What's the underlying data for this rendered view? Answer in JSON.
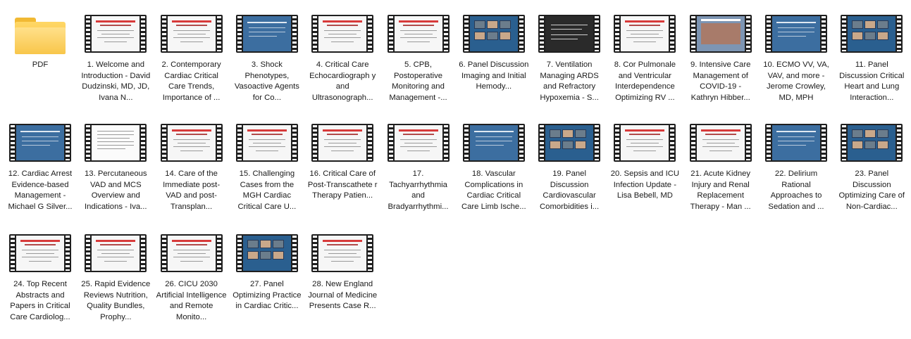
{
  "folder": {
    "label": "PDF"
  },
  "items": [
    {
      "label": "1. Welcome and Introduction - David Dudzinski, MD, JD, Ivana N...",
      "style": "slide"
    },
    {
      "label": "2. Contemporary Cardiac Critical Care Trends, Importance of ...",
      "style": "slide"
    },
    {
      "label": "3. Shock Phenotypes, Vasoactive Agents for Co...",
      "style": "blue"
    },
    {
      "label": "4. Critical Care Echocardiograph y and Ultrasonograph...",
      "style": "slide"
    },
    {
      "label": "5. CPB, Postoperative Monitoring and Management -...",
      "style": "slide"
    },
    {
      "label": "6. Panel Discussion Imaging and Initial Hemody...",
      "style": "panel"
    },
    {
      "label": "7. Ventilation Managing ARDS and Refractory Hypoxemia - S...",
      "style": "dark"
    },
    {
      "label": "8. Cor Pulmonale and Ventricular Interdependence Optimizing RV ...",
      "style": "slide"
    },
    {
      "label": "9. Intensive Care Management of COVID-19 - Kathryn Hibber...",
      "style": "photo"
    },
    {
      "label": "10. ECMO VV, VA, VAV, and more - Jerome Crowley, MD, MPH",
      "style": "blue"
    },
    {
      "label": "11. Panel Discussion Critical Heart and Lung Interaction...",
      "style": "panel"
    },
    {
      "label": "12. Cardiac Arrest Evidence-based Management - Michael G Silver...",
      "style": "blue"
    },
    {
      "label": "13. Percutaneous VAD and MCS Overview and Indications - Iva...",
      "style": "text"
    },
    {
      "label": "14. Care of the Immediate post-VAD and post-Transplan...",
      "style": "slide"
    },
    {
      "label": "15. Challenging Cases from the MGH Cardiac Critical Care U...",
      "style": "slide"
    },
    {
      "label": "16. Critical Care of Post-Transcathete r Therapy Patien...",
      "style": "slide"
    },
    {
      "label": "17. Tachyarrhythmia and Bradyarrhythmi...",
      "style": "slide"
    },
    {
      "label": "18. Vascular Complications in Cardiac Critical Care Limb Ische...",
      "style": "blue"
    },
    {
      "label": "19. Panel Discussion Cardiovascular Comorbidities i...",
      "style": "panel"
    },
    {
      "label": "20. Sepsis and ICU Infection Update - Lisa Bebell, MD",
      "style": "slide"
    },
    {
      "label": "21. Acute Kidney Injury and Renal Replacement Therapy - Man ...",
      "style": "slide"
    },
    {
      "label": "22. Delirium Rational Approaches to Sedation and ...",
      "style": "blue"
    },
    {
      "label": "23. Panel Discussion Optimizing Care of Non-Cardiac...",
      "style": "panel"
    },
    {
      "label": "24. Top Recent Abstracts and Papers in Critical Care Cardiolog...",
      "style": "slide"
    },
    {
      "label": "25. Rapid Evidence Reviews Nutrition, Quality Bundles, Prophy...",
      "style": "slide"
    },
    {
      "label": "26. CICU 2030 Artificial Intelligence and Remote Monito...",
      "style": "slide"
    },
    {
      "label": "27. Panel Optimizing Practice in Cardiac Critic...",
      "style": "panel"
    },
    {
      "label": "28. New England Journal of Medicine Presents Case R...",
      "style": "slide"
    }
  ],
  "colors": {
    "slide_accent": "#d83a3a",
    "blue_bg": "#3c6ea0",
    "panel_bg": "#2a5f8f",
    "dark_bg": "#2a2a2a",
    "folder": "#f6bf3f"
  }
}
